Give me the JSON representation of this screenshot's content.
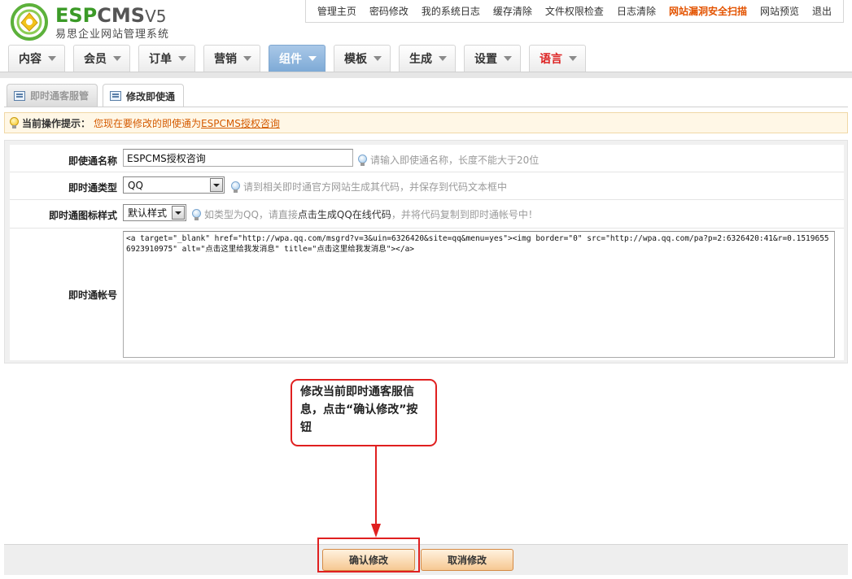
{
  "brand": {
    "name_esp": "ESP",
    "name_cms": "CMS",
    "version": "V5",
    "tagline": "易思企业网站管理系统"
  },
  "top_links": [
    {
      "label": "管理主页",
      "alert": false
    },
    {
      "label": "密码修改",
      "alert": false
    },
    {
      "label": "我的系统日志",
      "alert": false
    },
    {
      "label": "缓存清除",
      "alert": false
    },
    {
      "label": "文件权限检查",
      "alert": false
    },
    {
      "label": "日志清除",
      "alert": false
    },
    {
      "label": "网站漏洞安全扫描",
      "alert": true
    },
    {
      "label": "网站预览",
      "alert": false
    },
    {
      "label": "退出",
      "alert": false
    }
  ],
  "main_tabs": [
    {
      "label": "内容",
      "active": false
    },
    {
      "label": "会员",
      "active": false
    },
    {
      "label": "订单",
      "active": false
    },
    {
      "label": "营销",
      "active": false
    },
    {
      "label": "组件",
      "active": true
    },
    {
      "label": "模板",
      "active": false
    },
    {
      "label": "生成",
      "active": false
    },
    {
      "label": "设置",
      "active": false
    },
    {
      "label": "语言",
      "active": false
    }
  ],
  "sub_tabs": [
    {
      "label": "即时通客服管",
      "active": false
    },
    {
      "label": "修改即使通",
      "active": true
    }
  ],
  "tip": {
    "label": "当前操作提示：",
    "text": "您现在要修改的即使通为",
    "link": "ESPCMS授权咨询"
  },
  "form": {
    "name": {
      "label": "即使通名称",
      "value": "ESPCMS授权咨询",
      "hint": "请输入即使通名称，长度不能大于20位"
    },
    "type": {
      "label": "即时通类型",
      "value": "QQ",
      "hint": "请到相关即时通官方网站生成其代码，并保存到代码文本框中"
    },
    "style": {
      "label": "即时通图标样式",
      "value": "默认样式",
      "hint_before": "如类型为QQ，请直接",
      "hint_link": "点击生成QQ在线代码",
      "hint_after": "，并将代码复制到即时通帐号中！"
    },
    "account": {
      "label": "即时通帐号",
      "value": "<a target=\"_blank\" href=\"http://wpa.qq.com/msgrd?v=3&uin=6326420&site=qq&menu=yes\"><img border=\"0\" src=\"http://wpa.qq.com/pa?p=2:6326420:41&r=0.15196556923910975\" alt=\"点击这里给我发消息\" title=\"点击这里给我发消息\"></a>"
    }
  },
  "callout": {
    "text": "修改当前即时通客服信息，点击“确认修改”按钮"
  },
  "buttons": {
    "confirm": "确认修改",
    "cancel": "取消修改"
  },
  "colors": {
    "accent_alert": "#e35300",
    "annotation_red": "#e02020",
    "active_tab": "#7eaad6",
    "brand_green": "#3b9a27"
  }
}
